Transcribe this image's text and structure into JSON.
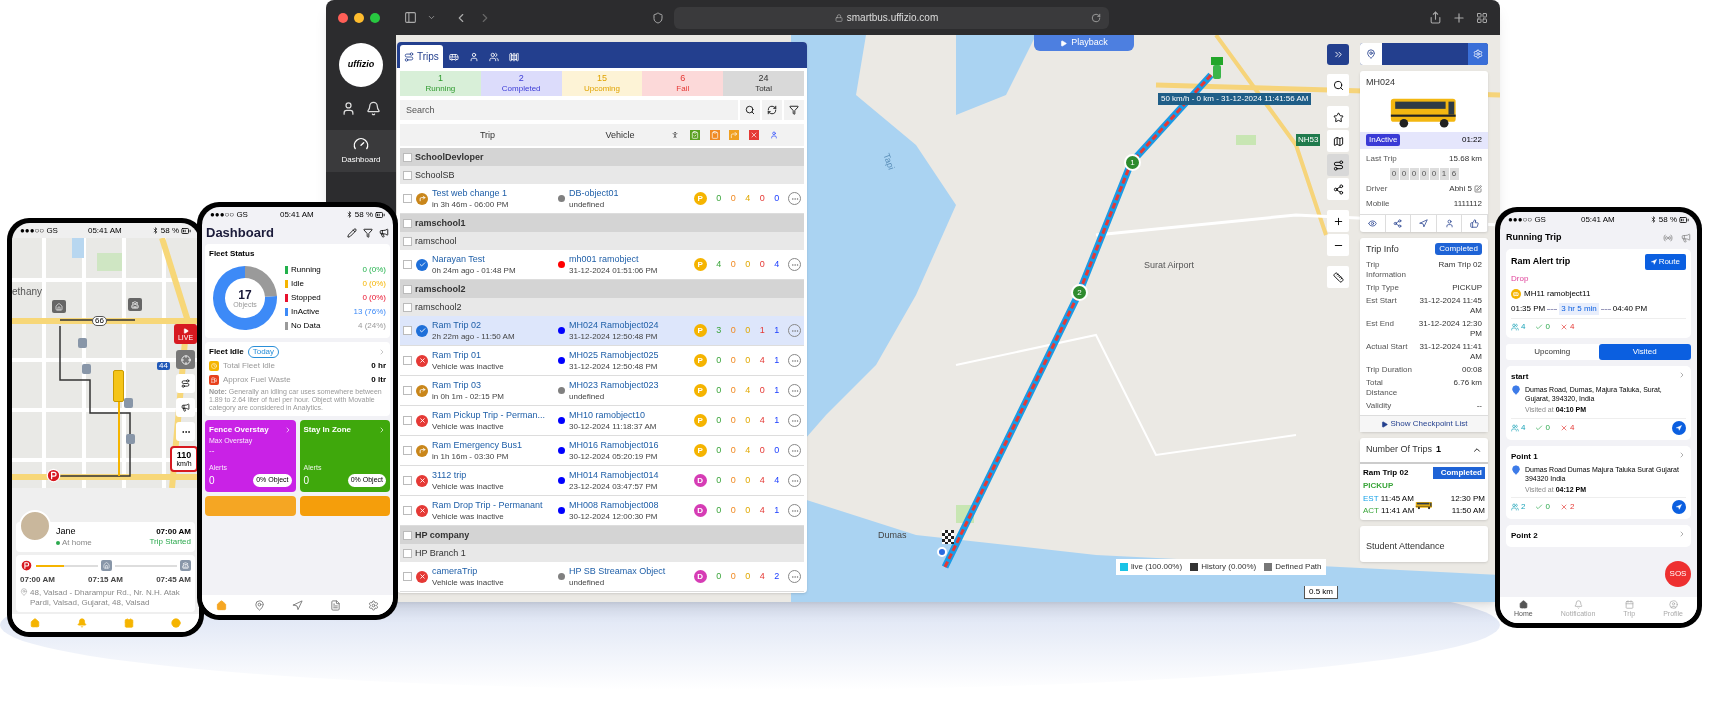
{
  "browser": {
    "url": "smartbus.uffizio.com"
  },
  "sidebar": {
    "logo": "uffizio",
    "items": [
      {
        "kind": "dashboard",
        "label": "Dashboard",
        "selected": true
      }
    ]
  },
  "trips_panel": {
    "tabs": [
      {
        "kind": "route",
        "label": "Trips",
        "selected": true
      },
      {
        "kind": "bus",
        "selected": false
      },
      {
        "kind": "driver",
        "selected": false
      },
      {
        "kind": "student",
        "selected": false
      },
      {
        "kind": "fence",
        "selected": false
      }
    ],
    "summary": [
      {
        "kind": "running",
        "count": "1",
        "label": "Running"
      },
      {
        "kind": "completed",
        "count": "2",
        "label": "Completed"
      },
      {
        "kind": "upcoming",
        "count": "15",
        "label": "Upcoming"
      },
      {
        "kind": "fail",
        "count": "6",
        "label": "Fail"
      },
      {
        "kind": "total",
        "count": "24",
        "label": "Total"
      }
    ],
    "search": {
      "placeholder": "Search"
    },
    "columns": [
      "Trip",
      "Vehicle"
    ],
    "status_columns": [
      {
        "kind": "walk"
      },
      {
        "kind": "present"
      },
      {
        "kind": "pending"
      },
      {
        "kind": "shared"
      },
      {
        "kind": "absent"
      },
      {
        "kind": "person"
      }
    ],
    "rows": [
      {
        "kind": "group",
        "label": "SchoolDevloper",
        "checked": false
      },
      {
        "kind": "subgroup",
        "label": "SchoolSB",
        "checked": false
      },
      {
        "kind": "trip",
        "status_icon": {
          "kind": "upcoming",
          "color": "#c9861a"
        },
        "name": "Test web change 1",
        "time": "in 3h 46m - 06:00 PM",
        "vehicle": "DB-object01",
        "vehicle_time": "undefined",
        "color": "#808080",
        "badge": {
          "label": "P",
          "color": "#f5b400"
        },
        "counts": [
          "0",
          "0",
          "4",
          "0",
          "0"
        ],
        "checked": false,
        "selected": false
      },
      {
        "kind": "group",
        "label": "ramschool1",
        "checked": false
      },
      {
        "kind": "subgroup",
        "label": "ramschool",
        "checked": false
      },
      {
        "kind": "trip",
        "status_icon": {
          "kind": "completed",
          "color": "#1e6fd9"
        },
        "name": "Narayan Test",
        "time": "0h 24m ago - 01:48 PM",
        "vehicle": "mh001 ramobject",
        "vehicle_time": "31-12-2024 01:51:06 PM",
        "color": "#ff0000",
        "badge": {
          "label": "P",
          "color": "#f5b400"
        },
        "counts": [
          "4",
          "0",
          "0",
          "0",
          "4"
        ],
        "checked": false,
        "selected": false
      },
      {
        "kind": "group",
        "label": "ramschool2",
        "checked": false
      },
      {
        "kind": "subgroup",
        "label": "ramschool2",
        "checked": false
      },
      {
        "kind": "trip",
        "status_icon": {
          "kind": "completed",
          "color": "#1e6fd9"
        },
        "name": "Ram Trip 02",
        "time": "2h 22m ago - 11:50 AM",
        "vehicle": "MH024 Ramobject024",
        "vehicle_time": "31-12-2024 12:50:48 PM",
        "color": "#0000ff",
        "badge": {
          "label": "P",
          "color": "#f5b400"
        },
        "counts": [
          "3",
          "0",
          "0",
          "1",
          "1"
        ],
        "checked": false,
        "selected": true
      },
      {
        "kind": "trip",
        "status_icon": {
          "kind": "failed",
          "color": "#e53935"
        },
        "name": "Ram Trip 01",
        "time": "Vehicle was inactive",
        "vehicle": "MH025 Ramobject025",
        "vehicle_time": "31-12-2024 12:50:48 PM",
        "color": "#0000ff",
        "badge": {
          "label": "P",
          "color": "#f5b400"
        },
        "counts": [
          "0",
          "0",
          "0",
          "4",
          "1"
        ],
        "checked": false,
        "selected": false
      },
      {
        "kind": "trip",
        "status_icon": {
          "kind": "upcoming",
          "color": "#c9861a"
        },
        "name": "Ram Trip 03",
        "time": "in 0h 1m - 02:15 PM",
        "vehicle": "MH023 Ramobject023",
        "vehicle_time": "undefined",
        "color": "#808080",
        "badge": {
          "label": "P",
          "color": "#f5b400"
        },
        "counts": [
          "0",
          "0",
          "4",
          "0",
          "1"
        ],
        "checked": false,
        "selected": false
      },
      {
        "kind": "trip",
        "status_icon": {
          "kind": "failed",
          "color": "#e53935"
        },
        "name": "Ram Pickup Trip - Perman...",
        "time": "Vehicle was inactive",
        "vehicle": "MH10 ramobject10",
        "vehicle_time": "30-12-2024 11:18:37 AM",
        "color": "#0000ff",
        "badge": {
          "label": "P",
          "color": "#f5b400"
        },
        "counts": [
          "0",
          "0",
          "0",
          "4",
          "1"
        ],
        "checked": false,
        "selected": false
      },
      {
        "kind": "trip",
        "status_icon": {
          "kind": "upcoming",
          "color": "#c9861a"
        },
        "name": "Ram Emergency Bus1",
        "time": "in 1h 16m - 03:30 PM",
        "vehicle": "MH016 Ramobject016",
        "vehicle_time": "30-12-2024 05:20:19 PM",
        "color": "#0000ff",
        "badge": {
          "label": "P",
          "color": "#f5b400"
        },
        "counts": [
          "0",
          "0",
          "4",
          "0",
          "0"
        ],
        "checked": false,
        "selected": false
      },
      {
        "kind": "trip",
        "status_icon": {
          "kind": "failed",
          "color": "#e53935"
        },
        "name": "3112 trip",
        "time": "Vehicle was inactive",
        "vehicle": "MH014 Ramobject014",
        "vehicle_time": "23-12-2024 03:47:57 PM",
        "color": "#0000ff",
        "badge": {
          "label": "D",
          "color": "#d63cb5"
        },
        "counts": [
          "0",
          "0",
          "0",
          "4",
          "4"
        ],
        "checked": false,
        "selected": false
      },
      {
        "kind": "trip",
        "status_icon": {
          "kind": "failed",
          "color": "#e53935"
        },
        "name": "Ram Drop Trip - Permanant",
        "time": "Vehicle was inactive",
        "vehicle": "MH008 Ramobject008",
        "vehicle_time": "30-12-2024 12:00:30 PM",
        "color": "#0000ff",
        "badge": {
          "label": "D",
          "color": "#d63cb5"
        },
        "counts": [
          "0",
          "0",
          "0",
          "4",
          "1"
        ],
        "checked": false,
        "selected": false
      },
      {
        "kind": "group",
        "label": "HP company",
        "checked": false
      },
      {
        "kind": "subgroup",
        "label": "HP Branch 1",
        "checked": false
      },
      {
        "kind": "trip",
        "status_icon": {
          "kind": "failed",
          "color": "#e53935"
        },
        "name": "cameraTrip",
        "time": "Vehicle was inactive",
        "vehicle": "HP SB Streamax Object",
        "vehicle_time": "undefined",
        "color": "#808080",
        "badge": {
          "label": "D",
          "color": "#d63cb5"
        },
        "counts": [
          "0",
          "0",
          "0",
          "4",
          "2"
        ],
        "checked": false,
        "selected": false
      }
    ]
  },
  "map": {
    "playback": "Playback",
    "tooltip": "50 km/h - 0 km - 31-12-2024 11:41:56 AM",
    "road_label": "NH53",
    "places": [
      "Tapi",
      "Surat Airport",
      "Dumas"
    ],
    "checkpoints": [
      "1",
      "2"
    ],
    "legend": [
      {
        "label": "live (100.00%)",
        "color": "#19c3e6"
      },
      {
        "label": "History (0.00%)",
        "color": "#333333"
      },
      {
        "label": "Defined Path",
        "color": "#777777"
      }
    ],
    "scale": "0.5 km",
    "tools": [
      {
        "kind": "search",
        "selected": false
      },
      {
        "kind": "star",
        "selected": false
      },
      {
        "kind": "map",
        "selected": false
      },
      {
        "kind": "route",
        "selected": true
      },
      {
        "kind": "share",
        "selected": false
      },
      {
        "kind": "plus",
        "selected": false
      },
      {
        "kind": "minus",
        "selected": false
      },
      {
        "kind": "ruler",
        "selected": false
      }
    ]
  },
  "vehicle_card": {
    "plate": "MH024",
    "status": "InActive",
    "duration": "01:22",
    "last_trip_label": "Last Trip",
    "last_trip": "15.68 km",
    "odometer": [
      "0",
      "0",
      "0",
      "0",
      "0",
      "1",
      "6"
    ],
    "fields": [
      {
        "label": "Driver",
        "value": "Abhi 5",
        "editable": true
      },
      {
        "label": "Mobile",
        "value": "1111112",
        "editable": false
      }
    ],
    "actions": [
      {
        "kind": "eye"
      },
      {
        "kind": "share"
      },
      {
        "kind": "navigate"
      },
      {
        "kind": "person"
      },
      {
        "kind": "thumbs-up"
      }
    ]
  },
  "trip_info": {
    "title": "Trip Info",
    "status": "Completed",
    "fields": [
      {
        "label": "Trip Information",
        "value": "Ram Trip 02"
      },
      {
        "label": "Trip Type",
        "value": "PICKUP"
      },
      {
        "label": "Est Start",
        "value": "31-12-2024 11:45 AM"
      },
      {
        "label": "Est End",
        "value": "31-12-2024 12:30 PM"
      },
      {
        "label": "Actual Start",
        "value": "31-12-2024 11:41 AM"
      },
      {
        "label": "Trip Duration",
        "value": "00:08"
      },
      {
        "label": "Total Distance",
        "value": "6.76 km"
      },
      {
        "label": "Validity",
        "value": "--"
      }
    ],
    "link": "Show Checkpoint List"
  },
  "trip_count": {
    "title": "Number Of Trips",
    "count": "1",
    "expanded": true,
    "trip": {
      "name": "Ram Trip 02",
      "type": "PICKUP",
      "status": "Completed",
      "est_label": "EST",
      "est_start": "11:45 AM",
      "est_end": "12:30 PM",
      "act_label": "ACT",
      "act_start": "11:41 AM",
      "act_end": "11:50 AM"
    }
  },
  "attendance": {
    "title": "Student Attendance"
  },
  "phone_tracking": {
    "status_bar": {
      "carrier": "●●●○○ GS",
      "time": "05:41 AM",
      "battery": "58 %"
    },
    "map_label": "ethany",
    "shields": [
      "66",
      "44"
    ],
    "live": "LIVE",
    "speed": "110",
    "speed_unit": "km/h",
    "student": {
      "name": "Jane",
      "status": "At home",
      "time": "07:00 AM",
      "trip_status": "Trip Started"
    },
    "progress": {
      "times": [
        "07:00 AM",
        "07:15 AM",
        "07:45 AM"
      ],
      "segments": [
        {
          "level": 0.45
        }
      ],
      "address": "48, Valsad - Dharampur Rd., Nr. N.H. Atak Pardi, Valsad, Gujarat, 48, Valsad"
    },
    "nav": [
      {
        "kind": "home"
      },
      {
        "kind": "bell"
      },
      {
        "kind": "calendar"
      },
      {
        "kind": "profile"
      }
    ]
  },
  "phone_dashboard": {
    "status_bar": {
      "carrier": "●●●○○ GS",
      "time": "05:41 AM",
      "battery": "58 %"
    },
    "title": "Dashboard",
    "fleet_status": {
      "title": "Fleet Status",
      "total": "17",
      "legend": [
        {
          "value": "0 (0%)",
          "color": "#22b14c"
        },
        {
          "value": "0 (0%)",
          "color": "#f5b400"
        },
        {
          "value": "0 (0%)",
          "color": "#e8112d"
        },
        {
          "value": "13 (76%)",
          "color": "#3d8af7"
        },
        {
          "value": "4 (24%)",
          "color": "#9a9a9a"
        }
      ],
      "chart_data": {
        "type": "donut",
        "categories": [
          "Running",
          "Idle",
          "Stopped",
          "InActive",
          "No Data"
        ],
        "series": [
          {
            "name": "Objects",
            "values": [
              0,
              0,
              0,
              76,
              24
            ]
          }
        ]
      }
    },
    "fleet_idle": {
      "title": "Fleet Idle",
      "period": "Today",
      "rows": [
        {
          "kind": "idle",
          "label": "Total Fleet Idle",
          "value": "0 hr"
        },
        {
          "kind": "fuel",
          "label": "Approx Fuel Waste",
          "value": "0 ltr"
        }
      ],
      "note": "**Note:** Generally an idling car uses somewhere between 1.89 to 2.64 liter of fuel per hour. Object with Movable category are considered in Analytics."
    },
    "tiles": [
      {
        "title": "Fence Overstay",
        "color": "#c922e6",
        "lines": [
          {
            "label": "Max Overstay",
            "value": "--"
          }
        ],
        "alerts_label": "Alerts",
        "alerts": "0",
        "badge": "0% Object"
      },
      {
        "title": "Stay In Zone",
        "color": "#3fa80c",
        "alerts_label": "Alerts",
        "alerts": "0",
        "badge": "0% Object"
      }
    ],
    "nav": [
      {
        "kind": "home",
        "selected": true
      },
      {
        "kind": "person-pin",
        "selected": false
      },
      {
        "kind": "navigate",
        "selected": false
      },
      {
        "kind": "report",
        "selected": false
      },
      {
        "kind": "settings",
        "selected": false
      }
    ]
  },
  "phone_trip": {
    "status_bar": {
      "carrier": "●●●○○ GS",
      "time": "05:41 AM",
      "battery": "58 %"
    },
    "title": "Running Trip",
    "trip": {
      "name": "Ram Alert trip",
      "route_button": "Route",
      "type": "Drop",
      "vehicle": "MH11 ramobject11",
      "start": "01:35 PM",
      "duration": "3 hr 5 min",
      "end": "04:40 PM",
      "counts": [
        "4",
        "0",
        "4"
      ]
    },
    "tabs": [
      {
        "label": "Upcoming",
        "selected": false
      },
      {
        "label": "Visited",
        "selected": true
      }
    ],
    "checkpoints": [
      {
        "name": "start",
        "address": "Dumas Road, Dumas, Majura Taluka, Surat, Gujarat, 394320, India",
        "visited_label": "Visited at",
        "visited": "04:10 PM",
        "counts": [
          "4",
          "0",
          "4"
        ]
      },
      {
        "name": "Point 1",
        "address": "Dumas Road Dumas Majura Taluka Surat Gujarat 394320 India",
        "visited_label": "Visited at",
        "visited": "04:12 PM",
        "counts": [
          "2",
          "0",
          "2"
        ]
      },
      {
        "name": "Point 2"
      }
    ],
    "sos": "SOS",
    "nav": [
      {
        "kind": "home",
        "label": "Home",
        "selected": true
      },
      {
        "kind": "bell",
        "label": "Notification",
        "selected": false
      },
      {
        "kind": "calendar",
        "label": "Trip",
        "selected": false
      },
      {
        "kind": "profile",
        "label": "Profile",
        "selected": false
      }
    ]
  }
}
